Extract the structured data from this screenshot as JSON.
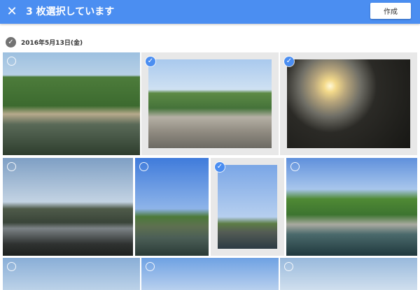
{
  "header": {
    "close_glyph": "✕",
    "title": "3 枚選択しています",
    "create_label": "作成",
    "background_color": "#4b8ef1"
  },
  "date_group": {
    "label": "2016年5月13日(金)",
    "check_glyph": "✓"
  },
  "photos": [
    {
      "selected": false
    },
    {
      "selected": true,
      "check_glyph": "✓"
    },
    {
      "selected": true,
      "check_glyph": "✓"
    },
    {
      "selected": false
    },
    {
      "selected": false
    },
    {
      "selected": true,
      "check_glyph": "✓"
    },
    {
      "selected": false
    },
    {
      "selected": false
    },
    {
      "selected": false
    },
    {
      "selected": false
    }
  ]
}
